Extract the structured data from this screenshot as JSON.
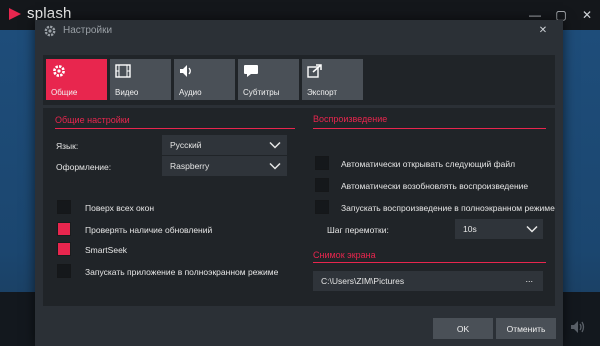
{
  "app": {
    "logo_text": "splash",
    "controls": [
      "—",
      "▢",
      "✕"
    ]
  },
  "dialog": {
    "title": "Настройки",
    "close_glyph": "✕"
  },
  "tabs": [
    {
      "label": "Общие",
      "icon": "gear-icon",
      "active": true
    },
    {
      "label": "Видео",
      "icon": "film-icon",
      "active": false
    },
    {
      "label": "Аудио",
      "icon": "speaker-icon",
      "active": false
    },
    {
      "label": "Субтитры",
      "icon": "speech-bubble-icon",
      "active": false
    },
    {
      "label": "Экспорт",
      "icon": "export-icon",
      "active": false
    }
  ],
  "general": {
    "section_title": "Общие настройки",
    "language": {
      "label": "Язык:",
      "value": "Русский"
    },
    "theme": {
      "label": "Оформление:",
      "value": "Raspberry"
    },
    "options": [
      {
        "label": "Поверх всех окон",
        "checked": false
      },
      {
        "label": "Проверять наличие обновлений",
        "checked": true
      },
      {
        "label": "SmartSeek",
        "checked": true
      },
      {
        "label": "Запускать приложение в полноэкранном режиме",
        "checked": false
      }
    ]
  },
  "playback": {
    "section_title": "Воспроизведение",
    "options": [
      {
        "label": "Автоматически открывать следующий файл",
        "checked": false
      },
      {
        "label": "Автоматически возобновлять воспроизведение",
        "checked": false
      },
      {
        "label": "Запускать воспроизведение в полноэкранном режиме",
        "checked": false
      }
    ],
    "seek_step": {
      "label": "Шаг перемотки:",
      "value": "10s"
    }
  },
  "screenshot": {
    "section_title": "Снимок экрана",
    "path": "C:\\Users\\ZIM\\Pictures",
    "browse": "..."
  },
  "footer": {
    "ok": "OK",
    "cancel": "Отменить"
  },
  "colors": {
    "accent": "#e8264e",
    "dialog_bg": "#2b3036",
    "pane_bg": "#202428"
  }
}
